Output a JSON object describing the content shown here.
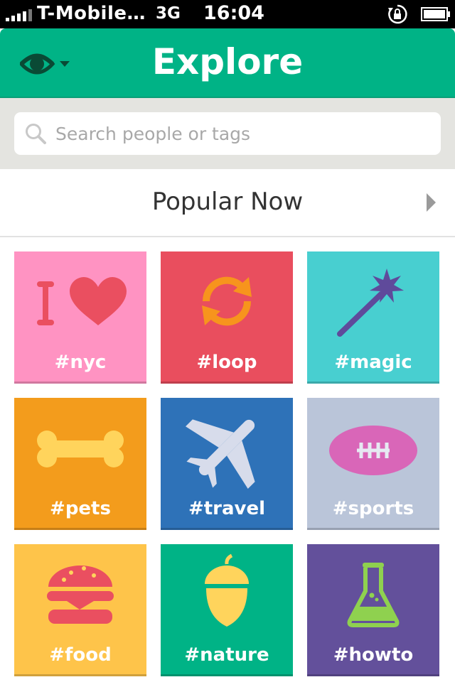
{
  "status_bar": {
    "carrier": "T-Mobile…",
    "network": "3G",
    "time": "16:04"
  },
  "nav": {
    "title": "Explore",
    "menu_icon": "eye-icon",
    "bar_color": "#00b386"
  },
  "search": {
    "placeholder": "Search people or tags",
    "value": ""
  },
  "popular": {
    "title": "Popular Now"
  },
  "tiles": [
    {
      "label": "#nyc",
      "icon": "i-heart-icon",
      "color": "#ff93c2"
    },
    {
      "label": "#loop",
      "icon": "loop-arrows-icon",
      "color": "#e94e5e"
    },
    {
      "label": "#magic",
      "icon": "magic-wand-icon",
      "color": "#48cfd0"
    },
    {
      "label": "#pets",
      "icon": "bone-icon",
      "color": "#f39c1c"
    },
    {
      "label": "#travel",
      "icon": "airplane-icon",
      "color": "#2e72b8"
    },
    {
      "label": "#sports",
      "icon": "football-icon",
      "color": "#bac5d9"
    },
    {
      "label": "#food",
      "icon": "burger-icon",
      "color": "#fec44a"
    },
    {
      "label": "#nature",
      "icon": "acorn-icon",
      "color": "#00b386"
    },
    {
      "label": "#howto",
      "icon": "flask-icon",
      "color": "#63509b"
    }
  ]
}
